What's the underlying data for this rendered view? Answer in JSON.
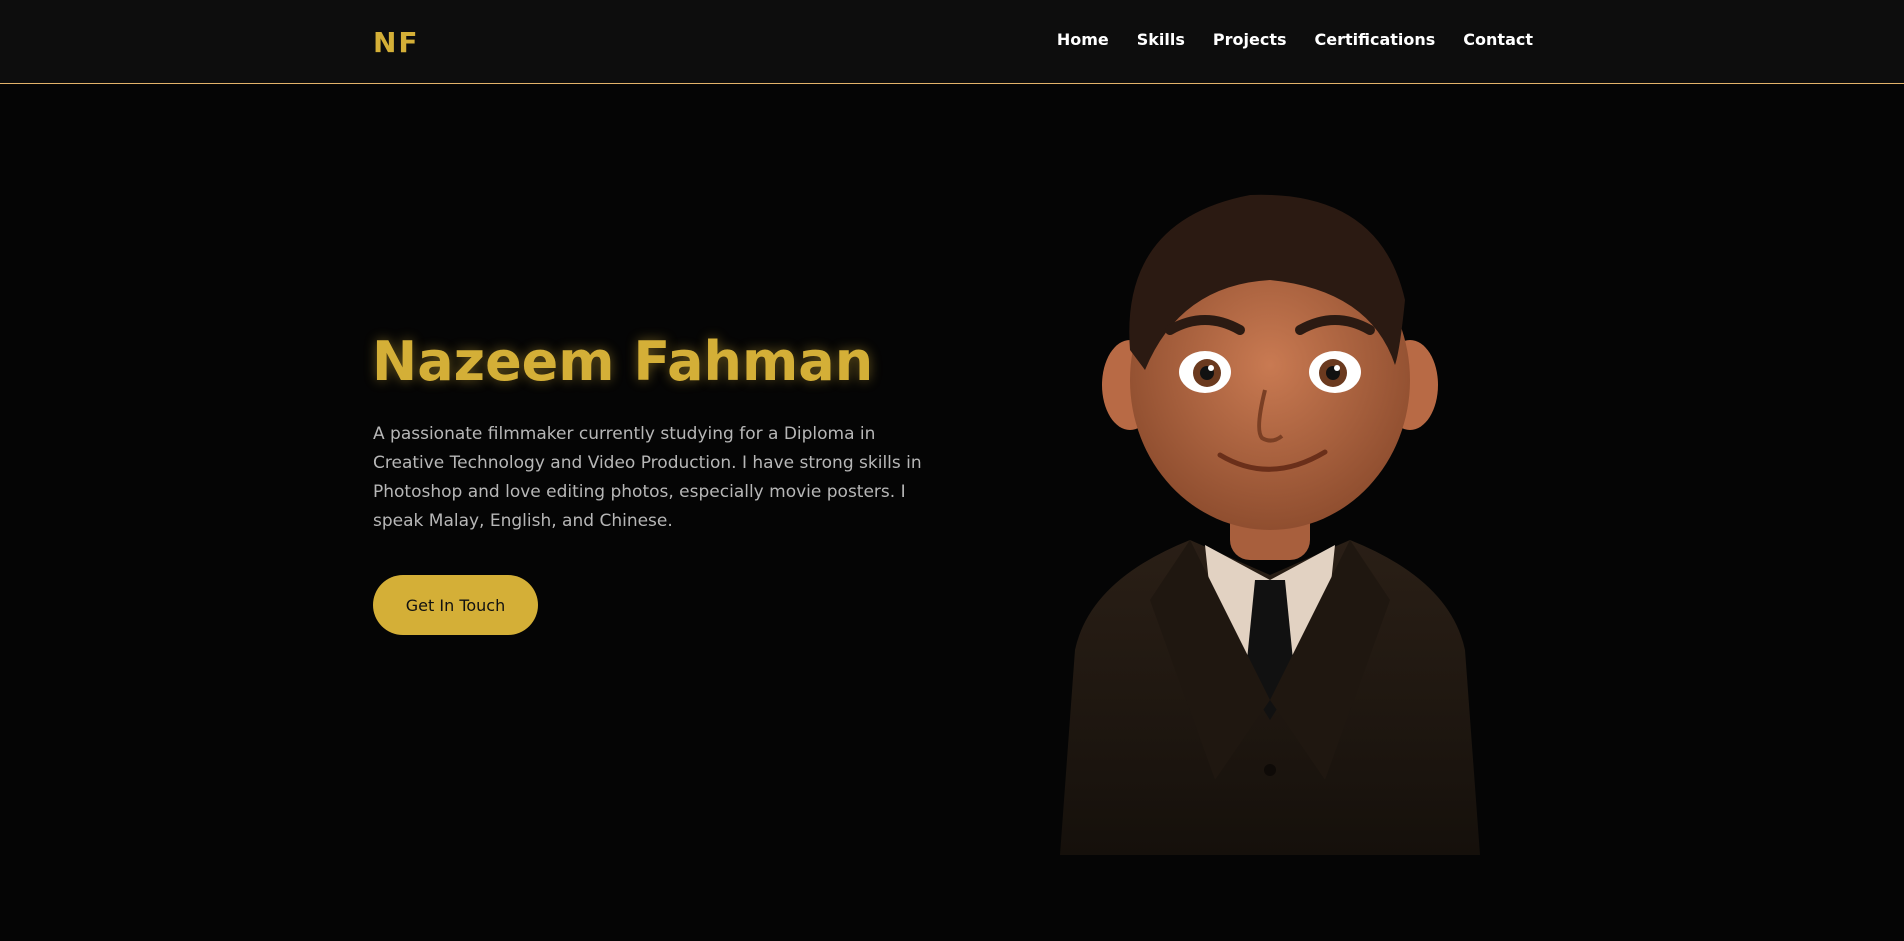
{
  "brand": {
    "logo": "NF",
    "accent": "#d4af37",
    "border": "#e3b36a"
  },
  "nav": {
    "items": [
      "Home",
      "Skills",
      "Projects",
      "Certifications",
      "Contact"
    ]
  },
  "hero": {
    "title": "Nazeem Fahman",
    "description": "A passionate filmmaker currently studying for a Diploma in Creative Technology and Video Production. I have strong skills in Photoshop and love editing photos, especially movie posters. I speak Malay, English, and Chinese.",
    "cta_label": "Get In Touch"
  },
  "portrait": {
    "icon": "avatar-portrait"
  }
}
